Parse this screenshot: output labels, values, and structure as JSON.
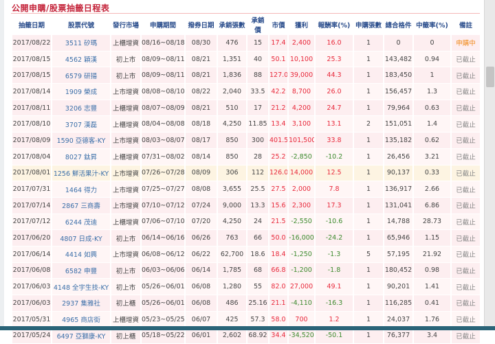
{
  "page": {
    "title": "公開申購/股票抽籤日程表"
  },
  "headers": [
    "抽籤日期",
    "股票代號",
    "發行市場",
    "申購期間",
    "撥券日期",
    "承銷張數",
    "承銷價",
    "市價",
    "獲利",
    "報酬率(%)",
    "申購張數",
    "總合格件",
    "中籤率(%)",
    "備註"
  ],
  "colors": {
    "title": "#c4243a",
    "header": "#2a4d8c",
    "gain": "#e8283a",
    "loss": "#3d8a2e",
    "status_active": "#f08a1c"
  },
  "rows": [
    [
      "2017/08/22",
      "3511 矽瑪",
      "上櫃增資",
      "08/16~08/18",
      "08/30",
      "476",
      "15",
      "17.4",
      "2,400",
      "16.0",
      "1",
      "0",
      "0",
      "申購中"
    ],
    [
      "2017/08/15",
      "4562 穎漢",
      "初上市",
      "08/09~08/11",
      "08/21",
      "1,351",
      "40",
      "50.1",
      "10,100",
      "25.3",
      "1",
      "143,482",
      "0.94",
      "已截止"
    ],
    [
      "2017/08/15",
      "6579 研揚",
      "初上市",
      "08/09~08/11",
      "08/21",
      "1,836",
      "88",
      "127.0",
      "39,000",
      "44.3",
      "1",
      "183,450",
      "1",
      "已截止"
    ],
    [
      "2017/08/14",
      "1909 榮成",
      "上市增資",
      "08/08~08/10",
      "08/22",
      "2,040",
      "33.5",
      "42.2",
      "8,700",
      "26.0",
      "1",
      "156,457",
      "1.3",
      "已截止"
    ],
    [
      "2017/08/11",
      "3206 志豐",
      "上櫃增資",
      "08/07~08/09",
      "08/21",
      "510",
      "17",
      "21.2",
      "4,200",
      "24.7",
      "1",
      "79,964",
      "0.63",
      "已截止"
    ],
    [
      "2017/08/10",
      "3707 漢磊",
      "上櫃增資",
      "08/04~08/08",
      "08/18",
      "4,250",
      "11.85",
      "13.4",
      "3,100",
      "13.1",
      "2",
      "151,051",
      "1.4",
      "已截止"
    ],
    [
      "2017/08/09",
      "1590 亞德客-KY",
      "上市增資",
      "08/03~08/07",
      "08/17",
      "850",
      "300",
      "401.5",
      "101,500",
      "33.8",
      "1",
      "135,182",
      "0.62",
      "已截止"
    ],
    [
      "2017/08/04",
      "8027 鈦昇",
      "上櫃增資",
      "07/31~08/02",
      "08/14",
      "850",
      "28",
      "25.2",
      "-2,850",
      "-10.2",
      "1",
      "26,456",
      "3.21",
      "已截止"
    ],
    [
      "2017/08/01",
      "1256 鮮活果汁-KY",
      "上市增資",
      "07/26~07/28",
      "08/09",
      "306",
      "112",
      "126.0",
      "14,000",
      "12.5",
      "1",
      "90,137",
      "0.33",
      "已截止"
    ],
    [
      "2017/07/31",
      "1464 得力",
      "上市增資",
      "07/25~07/27",
      "08/08",
      "3,655",
      "25.5",
      "27.5",
      "2,000",
      "7.8",
      "1",
      "136,917",
      "2.66",
      "已截止"
    ],
    [
      "2017/07/14",
      "2867 三商壽",
      "上市增資",
      "07/10~07/12",
      "07/24",
      "9,000",
      "13.3",
      "15.6",
      "2,300",
      "17.3",
      "1",
      "131,041",
      "6.86",
      "已截止"
    ],
    [
      "2017/07/12",
      "6244 茂迪",
      "上櫃增資",
      "07/06~07/10",
      "07/20",
      "4,250",
      "24",
      "21.5",
      "-2,550",
      "-10.6",
      "1",
      "14,788",
      "28.73",
      "已截止"
    ],
    [
      "2017/06/20",
      "4807 日成-KY",
      "初上市",
      "06/14~06/16",
      "06/26",
      "763",
      "66",
      "50.0",
      "-16,000",
      "-24.2",
      "1",
      "65,946",
      "1.15",
      "已截止"
    ],
    [
      "2017/06/14",
      "4414 如興",
      "上市增資",
      "06/08~06/12",
      "06/22",
      "62,700",
      "18.6",
      "18.4",
      "-1,250",
      "-1.3",
      "5",
      "57,195",
      "21.92",
      "已截止"
    ],
    [
      "2017/06/08",
      "6582 申豐",
      "初上市",
      "06/03~06/06",
      "06/14",
      "1,785",
      "68",
      "66.8",
      "-1,200",
      "-1.8",
      "1",
      "180,452",
      "0.98",
      "已截止"
    ],
    [
      "2017/06/03",
      "4148 全宇生技-KY",
      "初上市",
      "05/26~06/01",
      "06/08",
      "1,280",
      "55",
      "82.0",
      "27,000",
      "49.1",
      "1",
      "90,201",
      "1.41",
      "已截止"
    ],
    [
      "2017/06/03",
      "2937 集雅社",
      "初上櫃",
      "05/26~06/01",
      "06/08",
      "486",
      "25.16",
      "21.1",
      "-4,110",
      "-16.3",
      "1",
      "116,285",
      "0.41",
      "已截止"
    ],
    [
      "2017/05/31",
      "4965 商店街",
      "上櫃增資",
      "05/23~05/25",
      "06/07",
      "425",
      "57.3",
      "58.0",
      "700",
      "1.2",
      "1",
      "24,037",
      "1.76",
      "已截止"
    ],
    [
      "2017/05/24",
      "6497 亞獅康-KY",
      "初上櫃",
      "05/18~05/22",
      "06/01",
      "2,602",
      "68.92",
      "34.4",
      "-34,520",
      "-50.1",
      "1",
      "76,377",
      "3.4",
      "已截止"
    ]
  ]
}
